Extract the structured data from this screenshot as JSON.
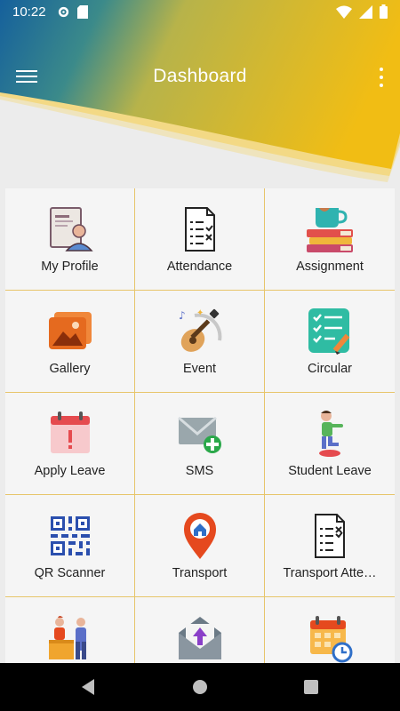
{
  "status_bar": {
    "time": "10:22"
  },
  "header": {
    "title": "Dashboard"
  },
  "tiles": [
    {
      "label": "My Profile",
      "icon": "profile-document-icon"
    },
    {
      "label": "Attendance",
      "icon": "checklist-icon"
    },
    {
      "label": "Assignment",
      "icon": "books-cup-icon"
    },
    {
      "label": "Gallery",
      "icon": "photo-gallery-icon"
    },
    {
      "label": "Event",
      "icon": "guitar-music-icon"
    },
    {
      "label": "Circular",
      "icon": "clipboard-checklist-icon"
    },
    {
      "label": "Apply Leave",
      "icon": "calendar-alert-icon"
    },
    {
      "label": "SMS",
      "icon": "envelope-plus-icon"
    },
    {
      "label": "Student Leave",
      "icon": "walking-student-icon"
    },
    {
      "label": "QR Scanner",
      "icon": "qr-code-icon"
    },
    {
      "label": "Transport",
      "icon": "location-pin-icon"
    },
    {
      "label": "Transport Atte…",
      "icon": "transport-checklist-icon"
    },
    {
      "label": "",
      "icon": "meeting-people-icon"
    },
    {
      "label": "",
      "icon": "envelope-upload-icon"
    },
    {
      "label": "",
      "icon": "calendar-clock-icon"
    }
  ],
  "colors": {
    "header_blue": "#1a69a6",
    "header_yellow": "#f0c419",
    "grid_border": "#e7c56a"
  }
}
